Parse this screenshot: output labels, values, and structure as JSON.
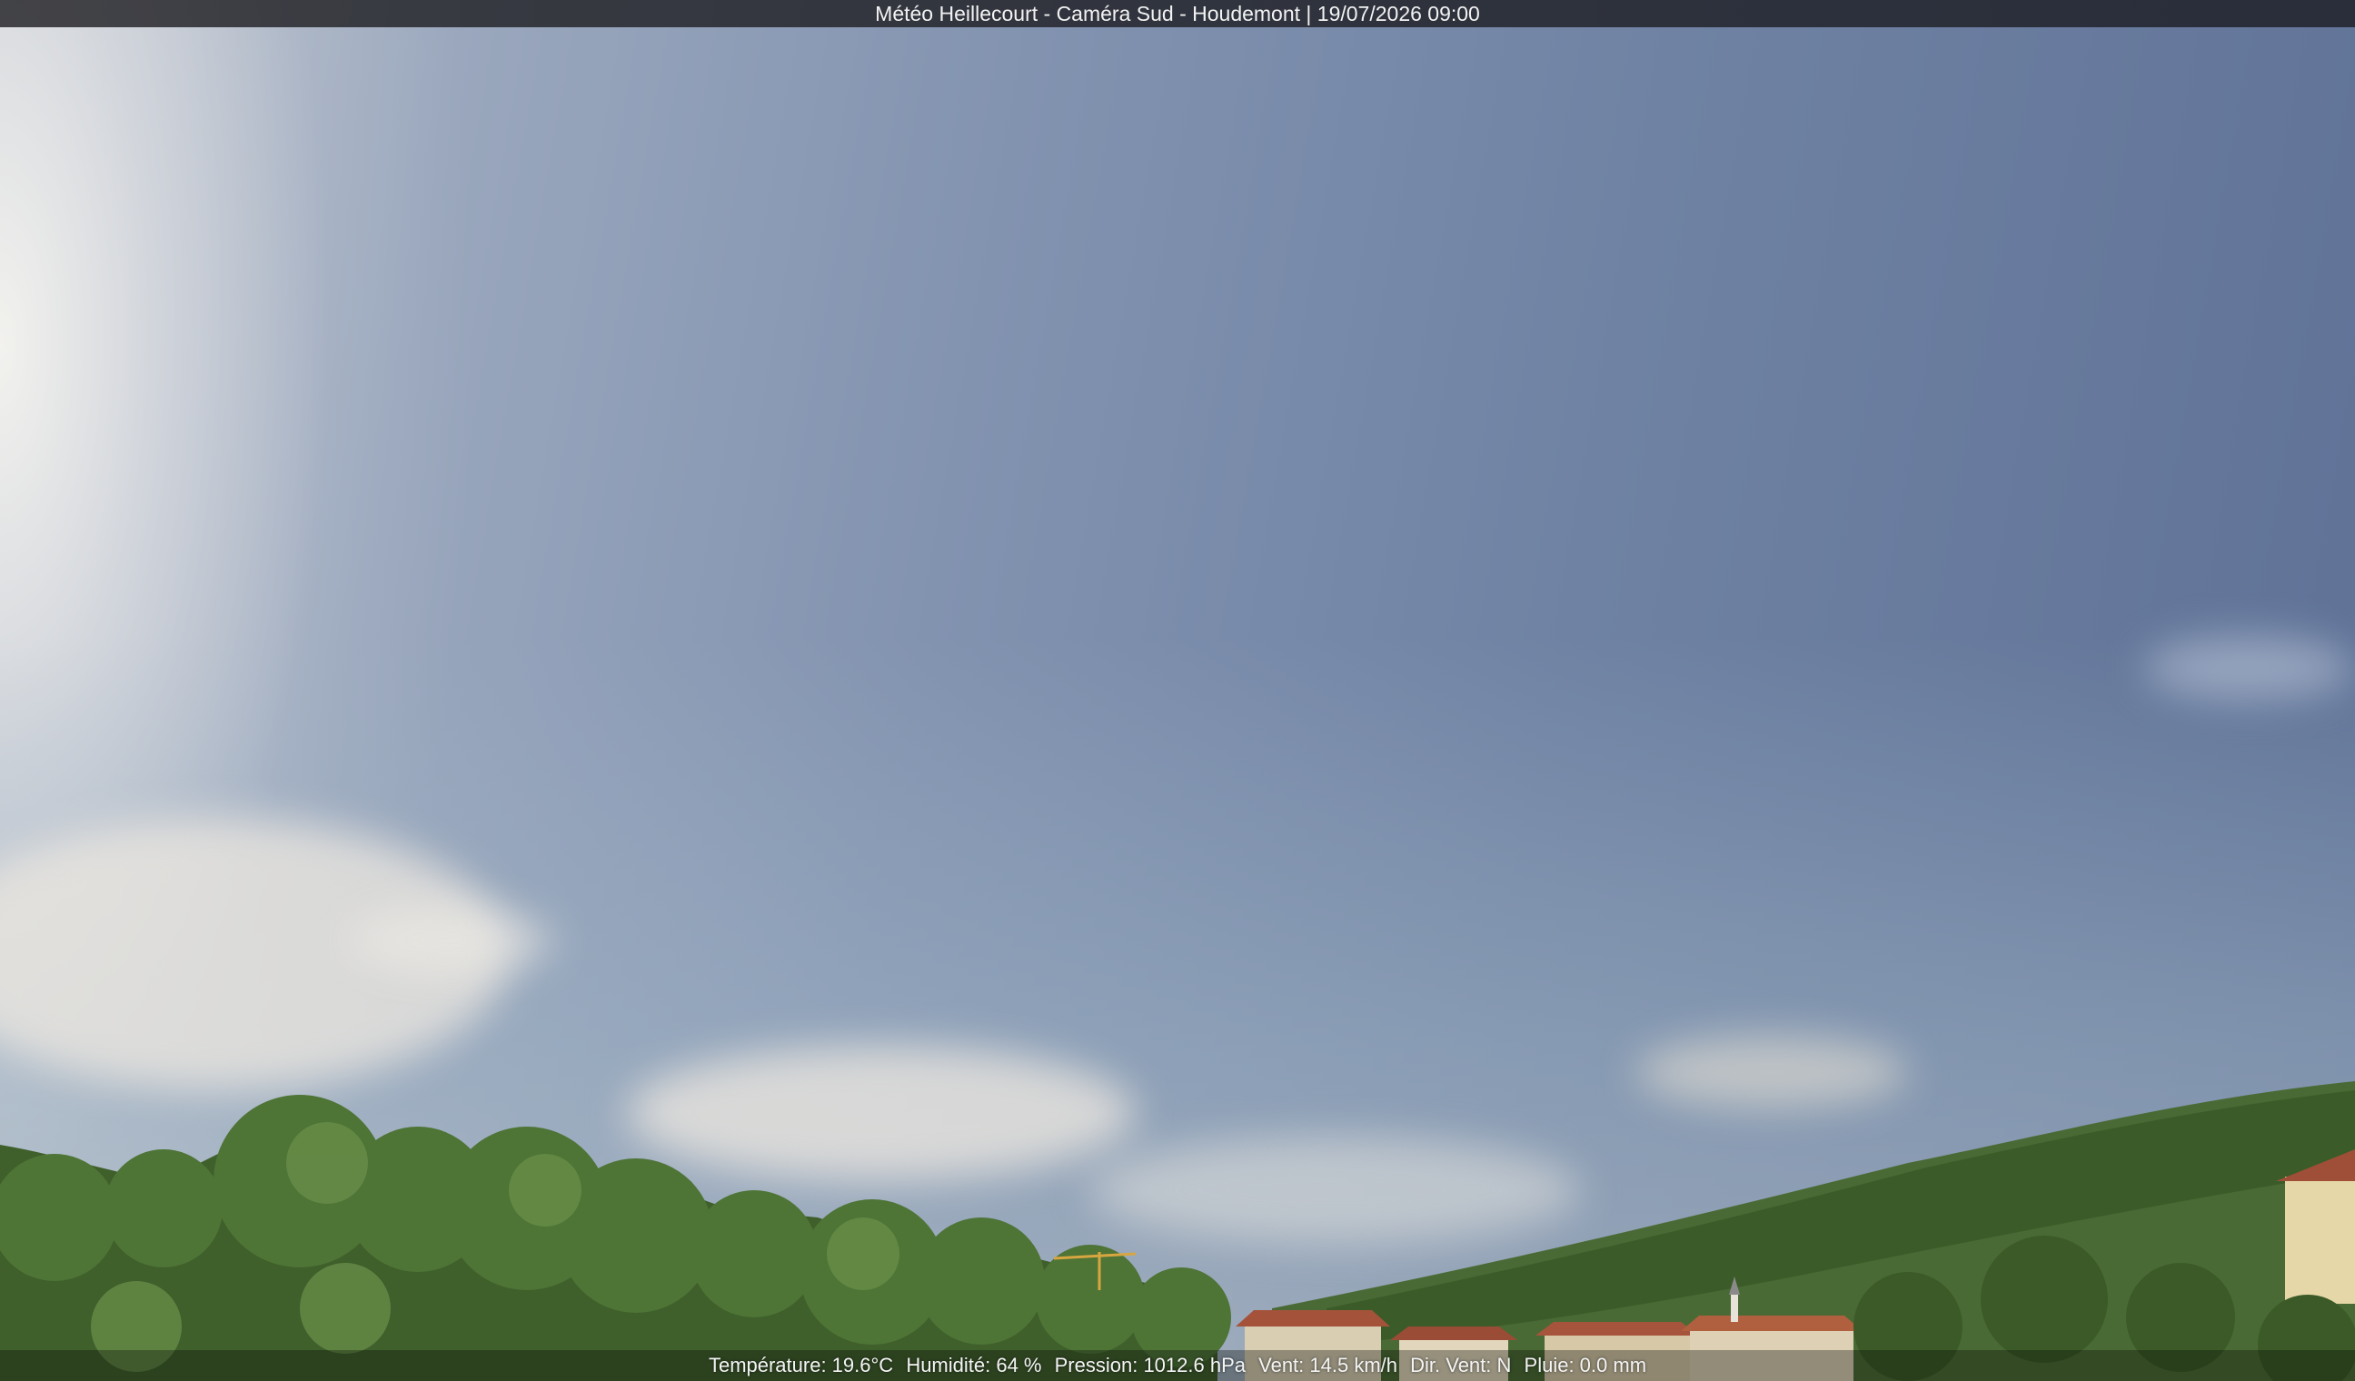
{
  "header": {
    "title": "Météo Heillecourt - Caméra Sud - Houdemont | 19/07/2026 09:00"
  },
  "weather": {
    "temperature": "Température: 19.6°C",
    "humidity": "Humidité: 64 %",
    "pressure": "Pression: 1012.6 hPa",
    "wind_speed": "Vent: 14.5 km/h",
    "wind_dir": "Dir. Vent: N",
    "rain": "Pluie: 0.0 mm"
  },
  "colors": {
    "sky_top": "#5e7196",
    "foliage": "#3d5a2a",
    "roof": "#a4533a"
  }
}
